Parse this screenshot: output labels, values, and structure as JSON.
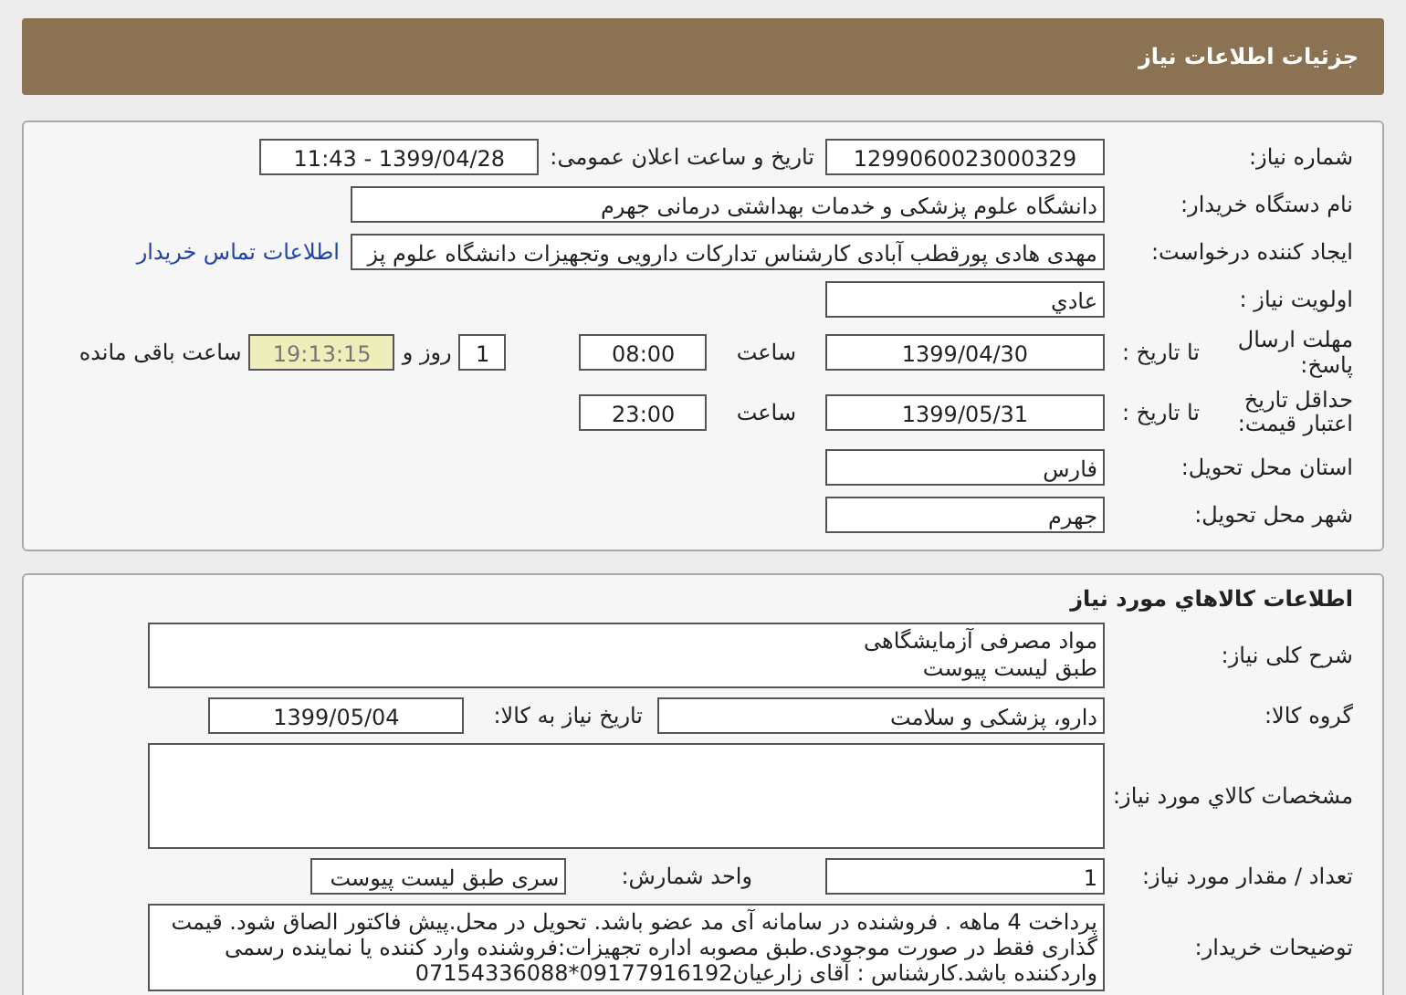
{
  "header": {
    "title": "جزئیات اطلاعات نیاز"
  },
  "need_info": {
    "need_number": {
      "label": "شماره نیاز:",
      "value": "1299060023000329"
    },
    "announce_datetime": {
      "label": "تاریخ و ساعت اعلان عمومی:",
      "value": "1399/04/28 - 11:43"
    },
    "buyer_org": {
      "label": "نام دستگاه خریدار:",
      "value": "دانشگاه علوم پزشکی و خدمات بهداشتی درمانی جهرم"
    },
    "requester": {
      "label": "ایجاد کننده درخواست:",
      "value": "مهدی هادی پورقطب آبادی کارشناس تدارکات دارویی وتجهیزات دانشگاه علوم پز",
      "link": "اطلاعات تماس خریدار"
    },
    "priority": {
      "label": "اولویت نیاز :",
      "value": "عادي"
    },
    "response_deadline": {
      "label": "مهلت ارسال پاسخ:",
      "date_label": "تا تاریخ :",
      "date": "1399/04/30",
      "time_label": "ساعت",
      "time": "08:00",
      "days": "1",
      "days_label": "روز و",
      "remaining": "19:13:15",
      "remaining_label": "ساعت باقی مانده"
    },
    "price_validity": {
      "label": "حداقل تاریخ اعتبار قیمت:",
      "date_label": "تا تاریخ :",
      "date": "1399/05/31",
      "time_label": "ساعت",
      "time": "23:00"
    },
    "province": {
      "label": "استان محل تحویل:",
      "value": "فارس"
    },
    "city": {
      "label": "شهر محل تحویل:",
      "value": "جهرم"
    }
  },
  "goods": {
    "title": "اطلاعات کالاهاي مورد نیاز",
    "description": {
      "label": "شرح کلی نیاز:",
      "lines": [
        "مواد مصرفی آزمایشگاهی",
        "طبق لیست پیوست"
      ]
    },
    "group": {
      "label": "گروه کالا:",
      "value": "دارو، پزشکی و سلامت"
    },
    "need_date": {
      "label": "تاریخ نیاز به کالا:",
      "value": "1399/05/04"
    },
    "specs": {
      "label": "مشخصات کالاي مورد نیاز:"
    },
    "quantity": {
      "label": "تعداد / مقدار مورد نیاز:",
      "value": "1"
    },
    "unit": {
      "label": "واحد شمارش:",
      "value": "سری طبق لیست پیوست"
    },
    "buyer_notes": {
      "label": "توضیحات خریدار:",
      "value": "پرداخت 4 ماهه . فروشنده در سامانه آی مد عضو باشد. تحویل در محل.پیش فاکتور الصاق شود. قیمت گذاری فقط در صورت موجودی.طبق مصوبه اداره تجهیزات:فروشنده وارد کننده یا نماینده رسمی واردکننده باشد.کارشناس : آقای زارعیان09177916192*07154336088"
    }
  }
}
